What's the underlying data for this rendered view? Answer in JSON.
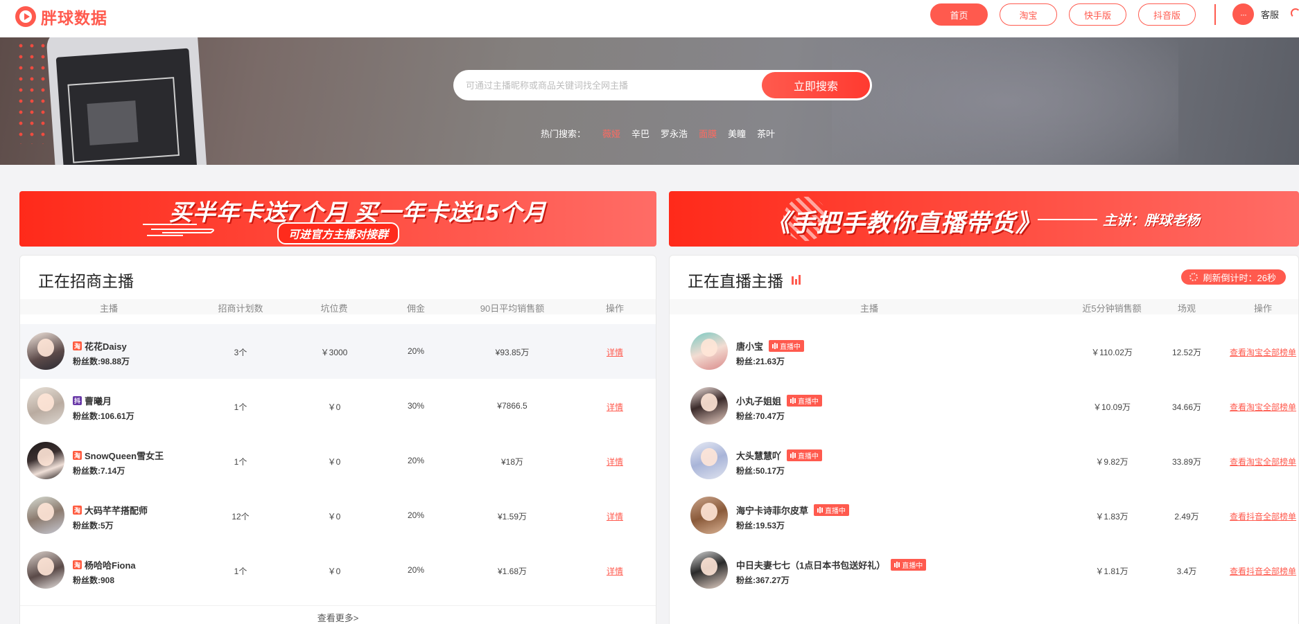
{
  "header": {
    "logo_text": "胖球数据",
    "nav": [
      {
        "label": "首页",
        "active": true
      },
      {
        "label": "淘宝",
        "active": false
      },
      {
        "label": "快手版",
        "active": false
      },
      {
        "label": "抖音版",
        "active": false
      }
    ],
    "service_icon": "···",
    "service_label": "客服"
  },
  "hero": {
    "search_placeholder": "可通过主播昵称或商品关键词找全网主播",
    "search_button": "立即搜索",
    "hot_label": "热门搜索：",
    "hot_items": [
      "薇娅",
      "辛巴",
      "罗永浩",
      "面膜",
      "美瞳",
      "茶叶"
    ]
  },
  "banners": {
    "left_main": "买半年卡送7个月   买一年卡送15个月",
    "left_sub": "可进官方主播对接群",
    "right_main": "《手把手教你直播带货》",
    "right_speaker": "主讲：胖球老杨"
  },
  "recruit": {
    "title": "正在招商主播",
    "columns": [
      "主播",
      "招商计划数",
      "坑位费",
      "佣金",
      "90日平均销售额",
      "操作"
    ],
    "rows": [
      {
        "platform": "淘",
        "name": "花花Daisy",
        "fans": "粉丝数:98.88万",
        "plans": "3个",
        "fee": "￥3000",
        "commission": "20%",
        "sales": "¥93.85万",
        "action": "详情"
      },
      {
        "platform": "抖",
        "name": "曹曦月",
        "fans": "粉丝数:106.61万",
        "plans": "1个",
        "fee": "￥0",
        "commission": "30%",
        "sales": "¥7866.5",
        "action": "详情"
      },
      {
        "platform": "淘",
        "name": "SnowQueen雪女王",
        "fans": "粉丝数:7.14万",
        "plans": "1个",
        "fee": "￥0",
        "commission": "20%",
        "sales": "¥18万",
        "action": "详情"
      },
      {
        "platform": "淘",
        "name": "大码芊芊搭配师",
        "fans": "粉丝数:5万",
        "plans": "12个",
        "fee": "￥0",
        "commission": "20%",
        "sales": "¥1.59万",
        "action": "详情"
      },
      {
        "platform": "淘",
        "name": "杨哈哈Fiona",
        "fans": "粉丝数:908",
        "plans": "1个",
        "fee": "￥0",
        "commission": "20%",
        "sales": "¥1.68万",
        "action": "详情"
      }
    ],
    "more": "查看更多>"
  },
  "live": {
    "title": "正在直播主播",
    "countdown": "刷新倒计时：26秒",
    "columns": [
      "主播",
      "近5分钟销售额",
      "场观",
      "操作"
    ],
    "live_tag": "直播中",
    "rows": [
      {
        "name": "唐小宝",
        "fans": "粉丝:21.63万",
        "sales": "￥110.02万",
        "views": "12.52万",
        "action": "查看淘宝全部榜单"
      },
      {
        "name": "小丸子姐姐",
        "fans": "粉丝:70.47万",
        "sales": "￥10.09万",
        "views": "34.66万",
        "action": "查看淘宝全部榜单"
      },
      {
        "name": "大头慧慧吖",
        "fans": "粉丝:50.17万",
        "sales": "￥9.82万",
        "views": "33.89万",
        "action": "查看淘宝全部榜单"
      },
      {
        "name": "海宁卡诗菲尔皮草",
        "fans": "粉丝:19.53万",
        "sales": "￥1.83万",
        "views": "2.49万",
        "action": "查看抖音全部榜单"
      },
      {
        "name": "中日夫妻七七（1点日本书包送好礼）",
        "fans": "粉丝:367.27万",
        "sales": "￥1.81万",
        "views": "3.4万",
        "action": "查看抖音全部榜单"
      }
    ]
  },
  "colors": {
    "accent": "#ff5a4e"
  }
}
